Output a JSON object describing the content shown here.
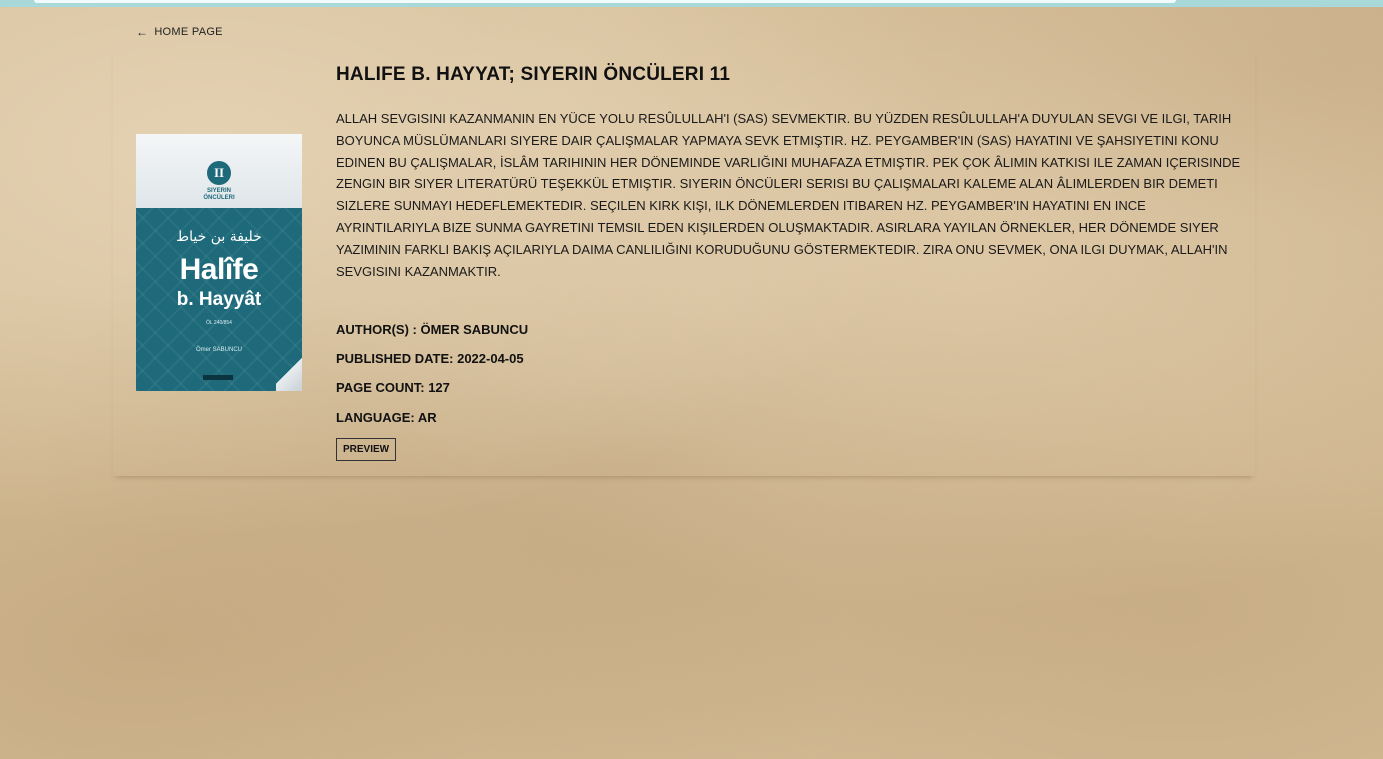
{
  "nav": {
    "home_arrow": "←",
    "home_label": "HOME PAGE"
  },
  "book": {
    "title": "HALIFE B. HAYYAT; SIYERIN ÖNCÜLERI 11",
    "description": "ALLAH SEVGISINI KAZANMANIN EN YÜCE YOLU RESÛLULLAH'I (SAS) SEVMEKTIR. BU YÜZDEN RESÛLULLAH'A DUYULAN SEVGI VE ILGI, TARIH BOYUNCA MÜSLÜMANLARI SIYERE DAIR ÇALIŞMALAR YAPMAYA SEVK ETMIŞTIR. HZ. PEYGAMBER'IN (SAS) HAYATINI VE ŞAHSIYETINI KONU EDINEN BU ÇALIŞMALAR, İSLÂM TARIHININ HER DÖNEMINDE VARLIĞINI MUHAFAZA ETMIŞTIR. PEK ÇOK ÂLIMIN KATKISI ILE ZAMAN IÇERISINDE ZENGIN BIR SIYER LITERATÜRÜ TEŞEKKÜL ETMIŞTIR. SIYERIN ÖNCÜLERI SERISI BU ÇALIŞMALARI KALEME ALAN ÂLIMLERDEN BIR DEMETI SIZLERE SUNMAYI HEDEFLEMEKTEDIR. SEÇILEN KIRK KIŞI, ILK DÖNEMLERDEN ITIBAREN HZ. PEYGAMBER'IN HAYATINI EN INCE AYRINTILARIYLA BIZE SUNMA GAYRETINI TEMSIL EDEN KIŞILERDEN OLUŞMAKTADIR. ASIRLARA YAYILAN ÖRNEKLER, HER DÖNEMDE SIYER YAZIMININ FARKLI BAKIŞ AÇILARIYLA DAIMA CANLILIĞINI KORUDUĞUNU GÖSTERMEKTEDIR. ZIRA ONU SEVMEK, ONA ILGI DUYMAK, ALLAH'IN SEVGISINI KAZANMAKTIR.",
    "author": "AUTHOR(S) : ÖMER SABUNCU",
    "published": "PUBLISHED DATE: 2022-04-05",
    "page_count": "PAGE COUNT: 127",
    "language": "LANGUAGE: AR",
    "preview_label": "PREVIEW"
  },
  "cover": {
    "number": "II",
    "series": "SIYERIN\nÖNCÜLERI",
    "arabic": "خليفة بن خياط",
    "title_line1": "Halîfe",
    "title_line2": "b. Hayyât",
    "subtitle": "ÖL 240/854",
    "author": "Ömer SABUNCU"
  },
  "colors": {
    "top_bar": "#a9d8d8",
    "background": "#d6bf9a",
    "cover_teal": "#1e6a7a"
  }
}
